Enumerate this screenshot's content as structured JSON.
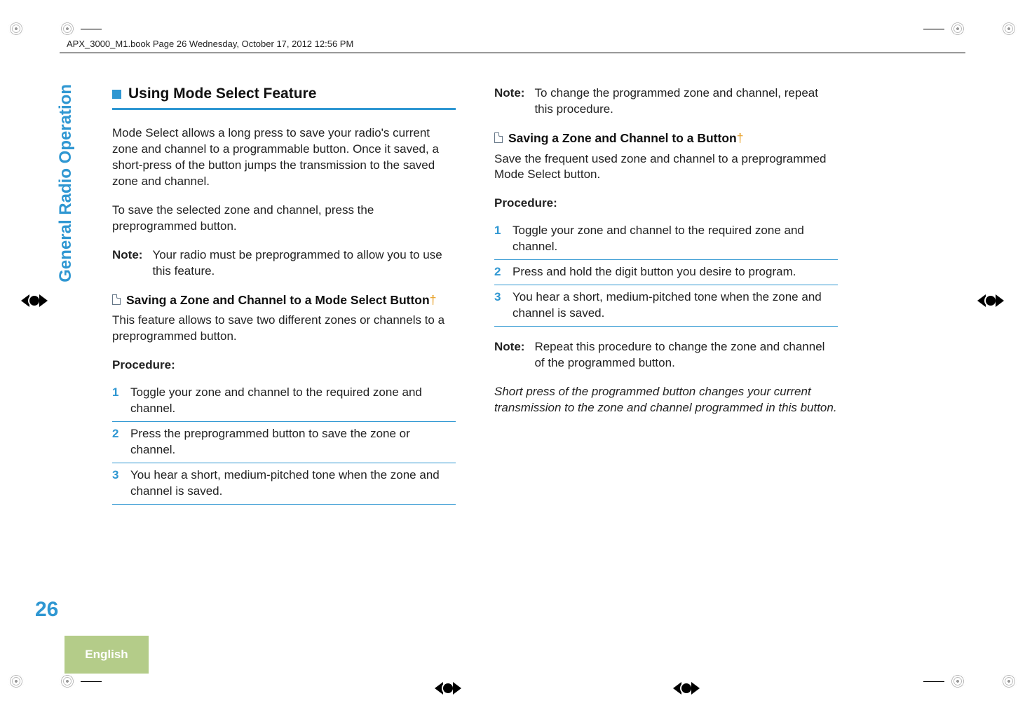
{
  "header": {
    "running_head": "APX_3000_M1.book  Page 26  Wednesday, October 17, 2012  12:56 PM"
  },
  "side": {
    "section": "General Radio Operation",
    "page_number": "26",
    "language": "English"
  },
  "left": {
    "section_title": "Using Mode Select Feature",
    "para1": "Mode Select allows a long press to save your radio's current zone and channel to a programmable button. Once it saved, a short-press of the button jumps the transmission to the saved zone and channel.",
    "para2": "To save the selected zone and channel, press the preprogrammed button.",
    "note_label": "Note:",
    "note_body": "Your radio must be preprogrammed to allow you to use this feature.",
    "sub_title": "Saving a Zone and Channel to a Mode Select Button",
    "dagger": "†",
    "sub_para": "This feature allows to save two different zones or channels to a preprogrammed button.",
    "procedure_label": "Procedure:",
    "steps": [
      {
        "n": "1",
        "t": "Toggle your zone and channel to the required zone and channel."
      },
      {
        "n": "2",
        "t": "Press the preprogrammed button to save the zone or channel."
      },
      {
        "n": "3",
        "t": "You hear a short, medium-pitched tone when the zone and channel is saved."
      }
    ]
  },
  "right": {
    "note1_label": "Note:",
    "note1_body": "To change the programmed zone and channel, repeat this procedure.",
    "sub_title": "Saving a Zone and Channel to a Button",
    "dagger": "†",
    "sub_para": "Save the frequent used zone and channel to a preprogrammed Mode Select button.",
    "procedure_label": "Procedure:",
    "steps": [
      {
        "n": "1",
        "t": "Toggle your zone and channel to the required zone and channel."
      },
      {
        "n": "2",
        "t": "Press and hold the digit button you desire to program."
      },
      {
        "n": "3",
        "t": "You hear a short, medium-pitched tone when the zone and channel is saved."
      }
    ],
    "note2_label": "Note:",
    "note2_body": "Repeat this procedure to change the zone and channel of the programmed button.",
    "closing": "Short press of the programmed button changes your current transmission to the zone and channel programmed in this button."
  }
}
